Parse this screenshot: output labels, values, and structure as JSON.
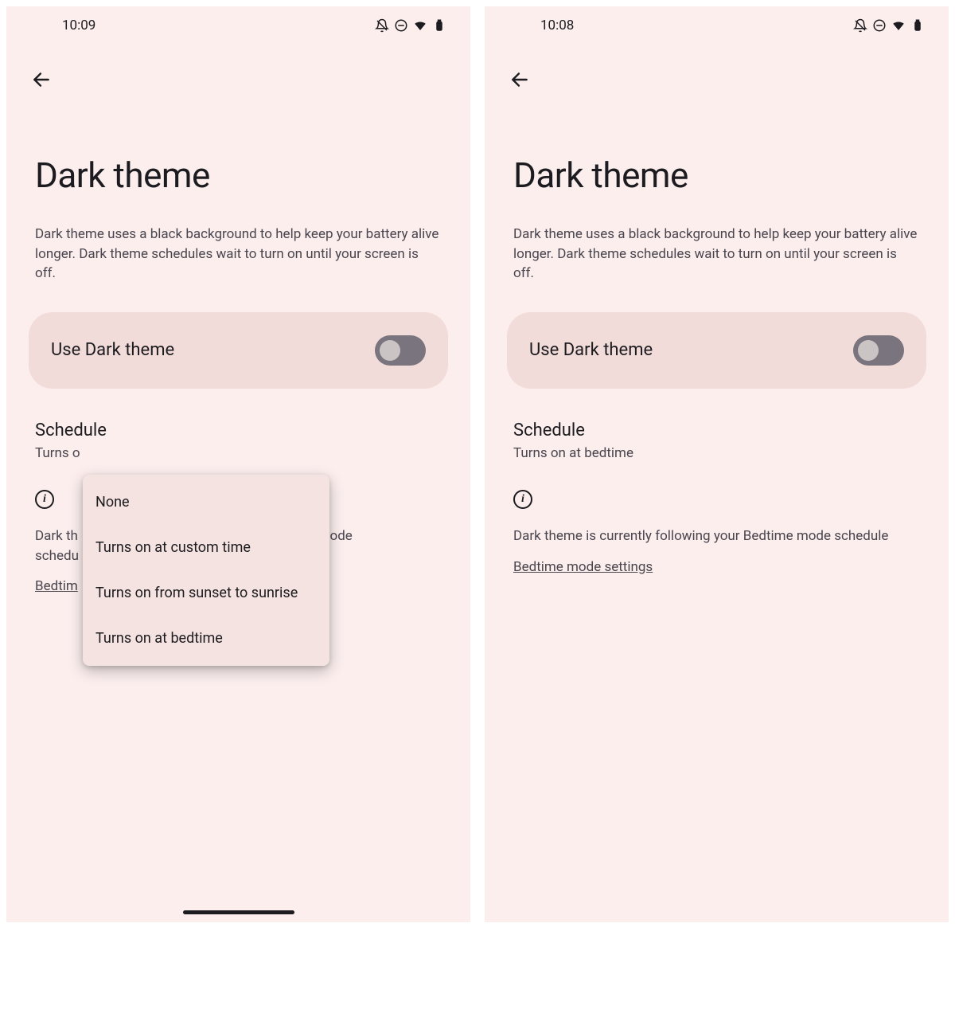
{
  "left": {
    "status_time": "10:09",
    "page_title": "Dark theme",
    "description": "Dark theme uses a black background to help keep your battery alive longer. Dark theme schedules wait to turn on until your screen is off.",
    "toggle_label": "Use Dark theme",
    "toggle_on": false,
    "schedule_title": "Schedule",
    "schedule_value_visible": "Turns o",
    "info_text_visible_left": "Dark th",
    "info_text_visible_right": "e mode",
    "info_text_line2_visible": "schedu",
    "link_visible": "Bedtim",
    "popup_items": [
      "None",
      "Turns on at custom time",
      "Turns on from sunset to sunrise",
      "Turns on at bedtime"
    ]
  },
  "right": {
    "status_time": "10:08",
    "page_title": "Dark theme",
    "description": "Dark theme uses a black background to help keep your battery alive longer. Dark theme schedules wait to turn on until your screen is off.",
    "toggle_label": "Use Dark theme",
    "toggle_on": false,
    "schedule_title": "Schedule",
    "schedule_value": "Turns on at bedtime",
    "info_text": "Dark theme is currently following your Bedtime mode schedule",
    "link_label": "Bedtime mode settings"
  }
}
